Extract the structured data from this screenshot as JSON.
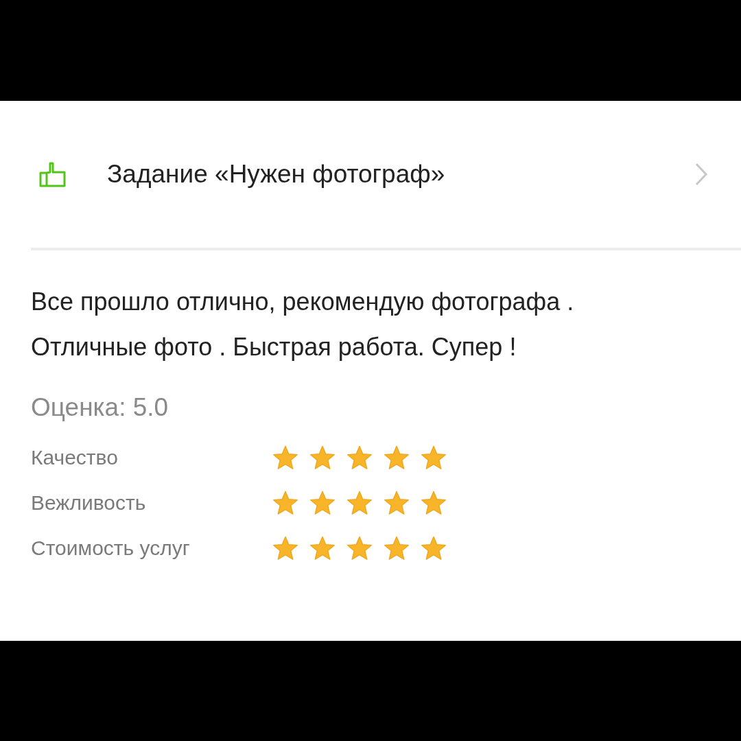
{
  "task": {
    "title": "Задание «Нужен фотограф»"
  },
  "review": {
    "text": "Все прошло отлично, рекомендую фотографа . Отличные фото . Быстрая работа. Супер !"
  },
  "rating": {
    "label": "Оценка: 5.0"
  },
  "criteria": [
    {
      "label": "Качество",
      "stars": 5
    },
    {
      "label": "Вежливость",
      "stars": 5
    },
    {
      "label": "Стоимость услуг",
      "stars": 5
    }
  ]
}
